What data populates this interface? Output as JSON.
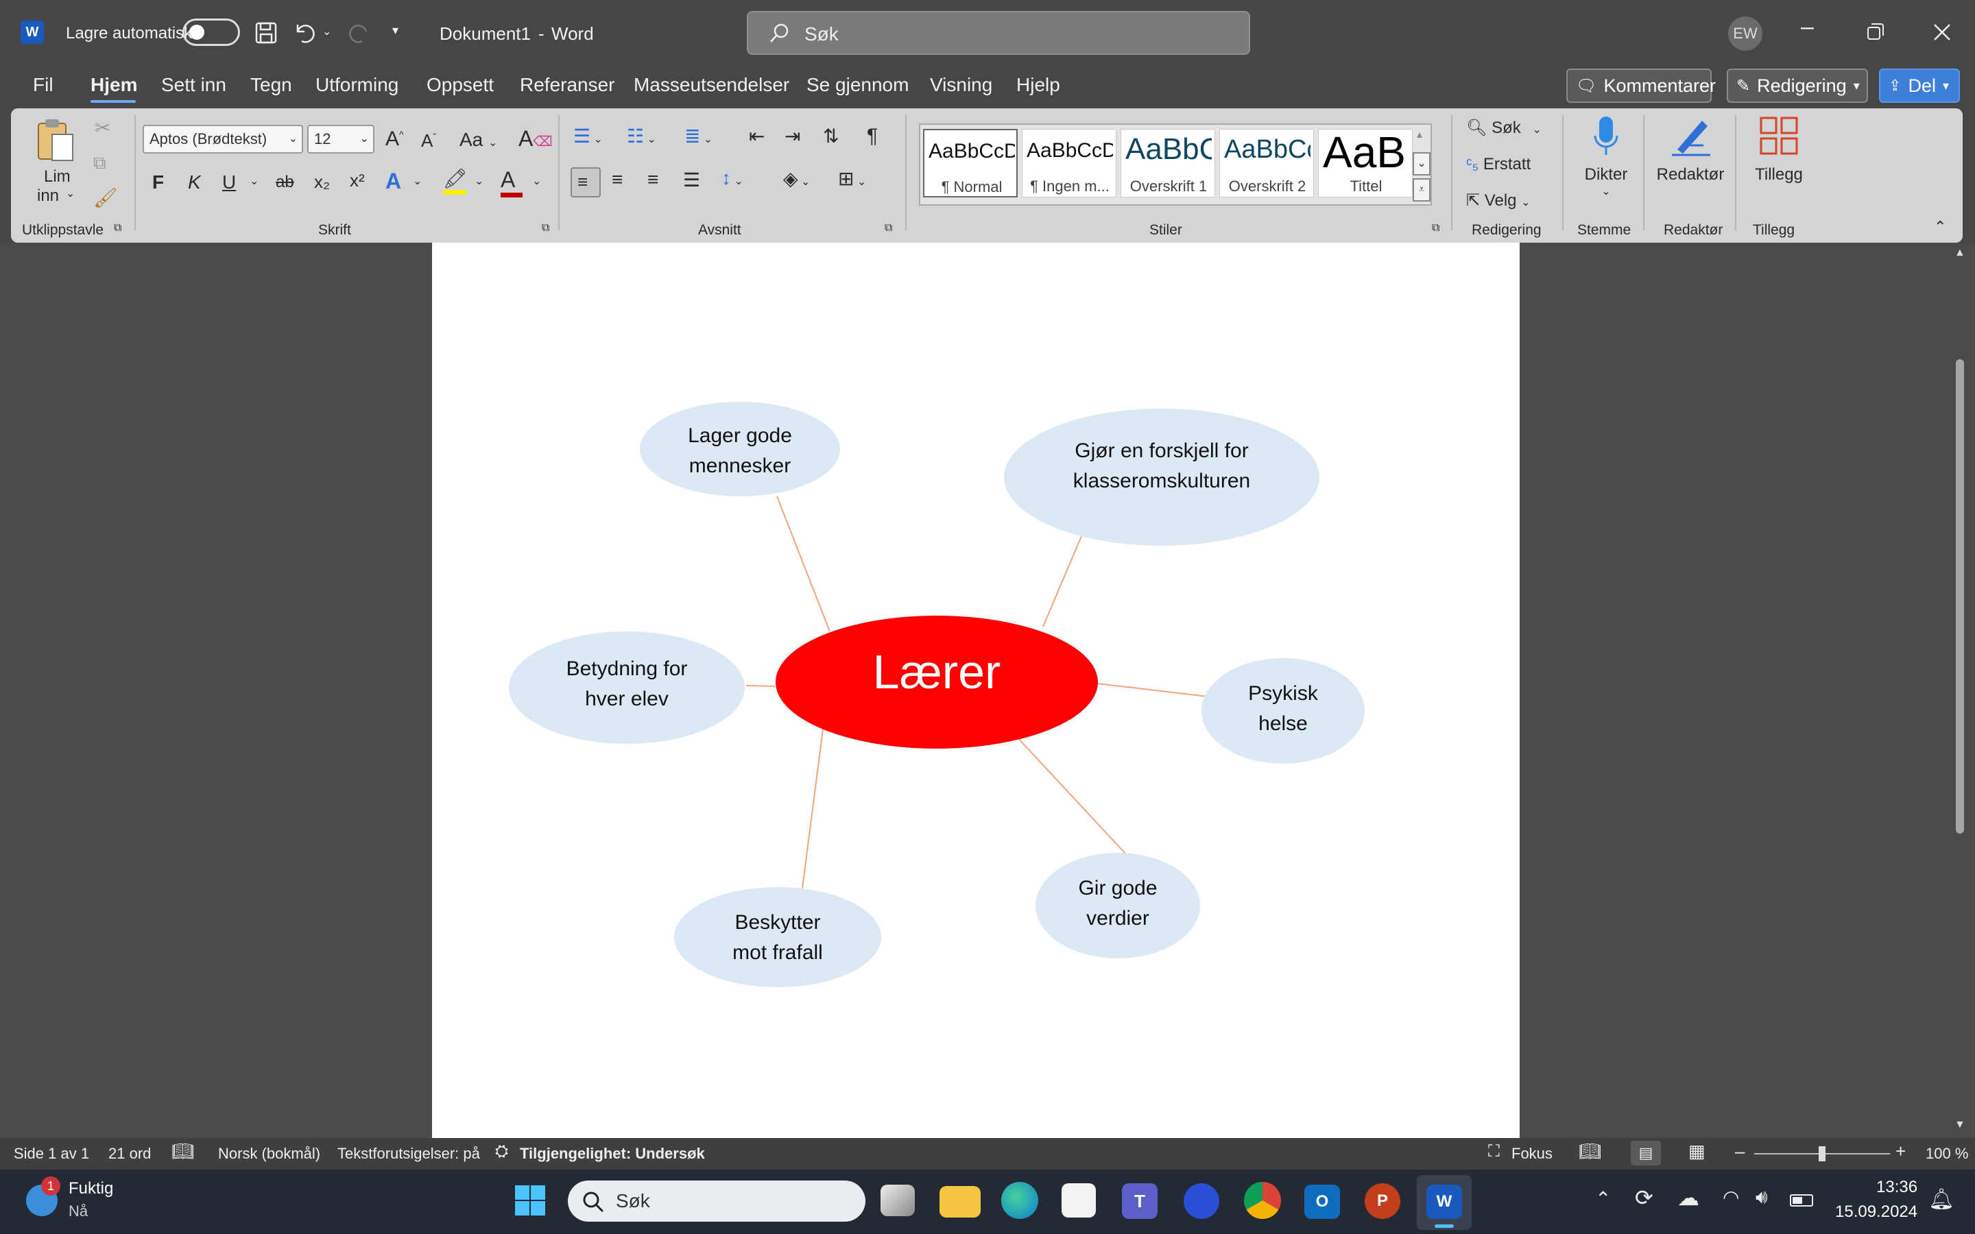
{
  "titlebar": {
    "autosave_label": "Lagre automatisk",
    "doc_name": "Dokument1",
    "separator": "-",
    "app_name": "Word",
    "search_placeholder": "Søk",
    "user_initials": "EW"
  },
  "menu": {
    "items": [
      "Fil",
      "Hjem",
      "Sett inn",
      "Tegn",
      "Utforming",
      "Oppsett",
      "Referanser",
      "Masseutsendelser",
      "Se gjennom",
      "Visning",
      "Hjelp"
    ],
    "active": "Hjem",
    "comments_label": "Kommentarer",
    "editing_label": "Redigering",
    "share_label": "Del"
  },
  "ribbon": {
    "clipboard": {
      "paste_line1": "Lim",
      "paste_line2": "inn",
      "group": "Utklippstavle"
    },
    "font": {
      "family": "Aptos (Brødtekst)",
      "size": "12",
      "bold": "F",
      "italic": "K",
      "underline": "U",
      "strike": "ab",
      "sub": "x₂",
      "sup": "x²",
      "case": "Aa",
      "group": "Skrift"
    },
    "paragraph": {
      "group": "Avsnitt"
    },
    "styles": {
      "tiles": [
        {
          "preview": "AaBbCcDd",
          "name": "¶ Normal"
        },
        {
          "preview": "AaBbCcDd",
          "name": "¶ Ingen m..."
        },
        {
          "preview": "AaBbCc",
          "name": "Overskrift 1"
        },
        {
          "preview": "AaBbCc",
          "name": "Overskrift 2"
        },
        {
          "preview": "AaB",
          "name": "Tittel"
        }
      ],
      "group": "Stiler"
    },
    "editing": {
      "find": "Søk",
      "replace": "Erstatt",
      "select": "Velg",
      "group": "Redigering"
    },
    "voice": {
      "dictate": "Dikter",
      "group": "Stemme"
    },
    "editor": {
      "label": "Redaktør",
      "group": "Redaktør"
    },
    "addins": {
      "label": "Tillegg",
      "group": "Tillegg"
    }
  },
  "mindmap": {
    "center": "Lærer",
    "nodes": [
      {
        "line1": "Lager gode",
        "line2": "mennesker"
      },
      {
        "line1": "Gjør en forskjell for",
        "line2": "klasseromskulturen"
      },
      {
        "line1": "Betydning for",
        "line2": "hver elev"
      },
      {
        "line1": "Psykisk",
        "line2": "helse"
      },
      {
        "line1": "Gir gode",
        "line2": "verdier"
      },
      {
        "line1": "Beskytter",
        "line2": "mot frafall"
      }
    ],
    "colors": {
      "center": "#ff0000",
      "node": "#dde8f5",
      "connector": "#f4a37a"
    }
  },
  "statusbar": {
    "page": "Side 1 av 1",
    "words": "21 ord",
    "language": "Norsk (bokmål)",
    "predictions": "Tekstforutsigelser: på",
    "accessibility": "Tilgjengelighet: Undersøk",
    "focus": "Fokus",
    "zoom": "100 %"
  },
  "taskbar": {
    "widget_title": "Fuktig",
    "widget_sub": "Nå",
    "widget_badge": "1",
    "search": "Søk",
    "time": "13:36",
    "date": "15.09.2024"
  }
}
